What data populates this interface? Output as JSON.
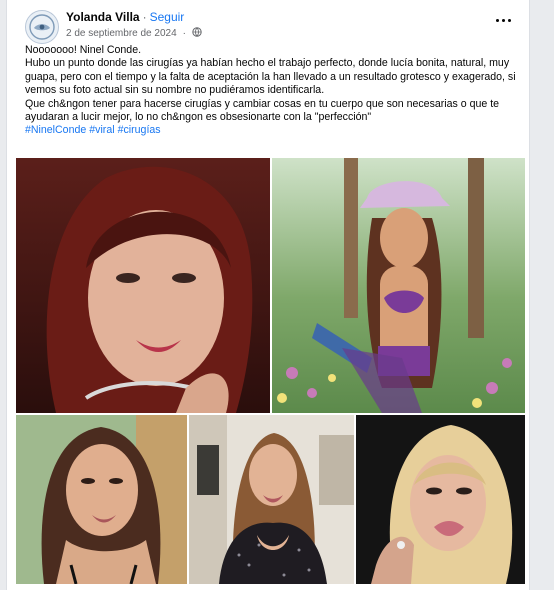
{
  "post": {
    "author": "Yolanda Villa",
    "separator": "·",
    "follow_label": "Seguir",
    "date": "2 de septiembre de 2024",
    "audience_icon": "globe-icon",
    "more_icon": "more-options-icon",
    "text_lines": [
      "Nooooooo! Ninel Conde.",
      "Hubo un punto donde las cirugías ya habían hecho el trabajo perfecto, donde lucía bonita, natural, muy guapa, pero con el tiempo y la falta de aceptación la han llevado a un resultado grotesco y exagerado, si vemos su foto actual sin su nombre no pudiéramos identificarla.",
      "Que ch&ngon tener para hacerse cirugías y cambiar cosas en tu cuerpo que son necesarias o que te ayudaran a lucir mejor, lo no ch&ngon es obsesionarte con la \"perfección\""
    ],
    "hashtags": [
      "#NinelConde",
      "#viral",
      "#cirugías"
    ]
  },
  "photos": [
    {
      "id": "photo-1",
      "subject": "woman-portrait-young"
    },
    {
      "id": "photo-2",
      "subject": "woman-cowgirl-hat"
    },
    {
      "id": "photo-3",
      "subject": "woman-portrait-dark-hair"
    },
    {
      "id": "photo-4",
      "subject": "woman-sequin-dress"
    },
    {
      "id": "photo-5",
      "subject": "woman-portrait-blonde"
    }
  ],
  "colors": {
    "link": "#1877f2",
    "text": "#050505",
    "secondary": "#65676b",
    "background": "#e9ebee"
  }
}
